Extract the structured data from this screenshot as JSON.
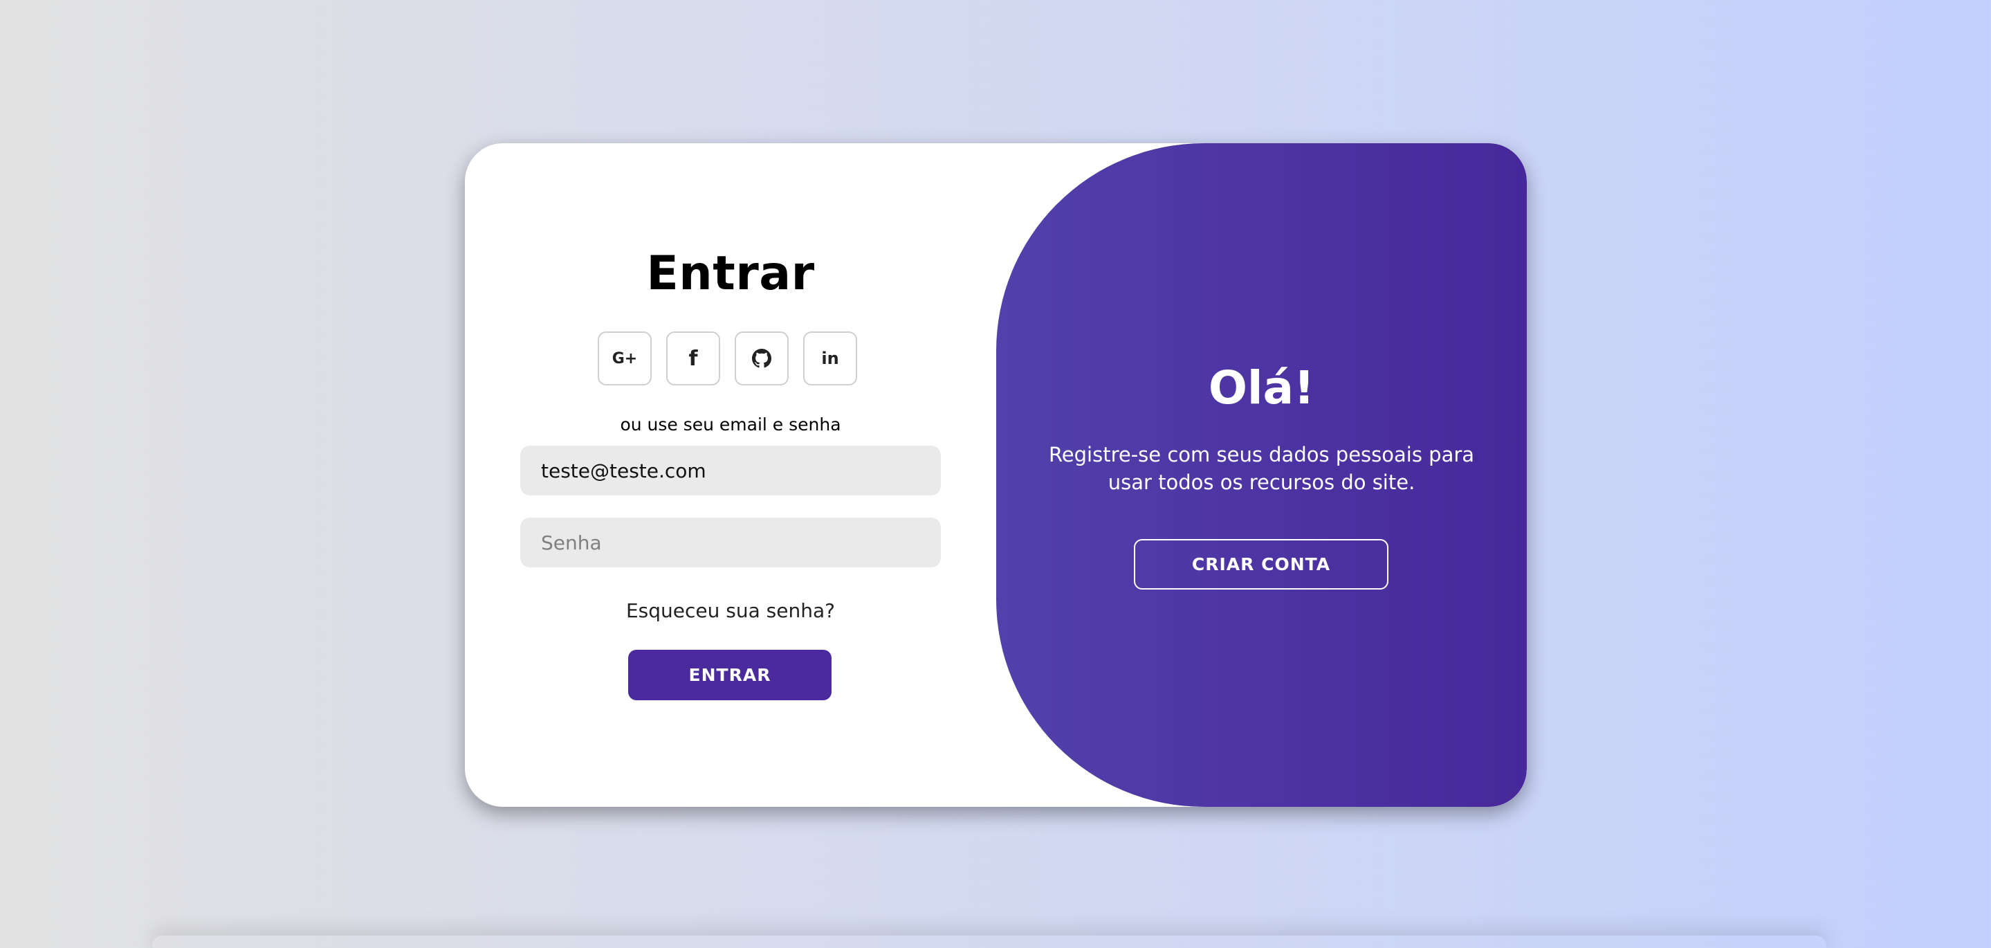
{
  "login": {
    "title": "Entrar",
    "socials": [
      {
        "icon": "google-plus-icon",
        "label": "G+"
      },
      {
        "icon": "facebook-icon",
        "label": "f"
      },
      {
        "icon": "github-icon",
        "label": ""
      },
      {
        "icon": "linkedin-icon",
        "label": "in"
      }
    ],
    "hint": "ou use seu email e senha",
    "email_value": "teste@teste.com",
    "password_placeholder": "Senha",
    "forgot_label": "Esqueceu sua senha?",
    "submit_label": "ENTRAR"
  },
  "panel": {
    "title": "Olá!",
    "text": "Registre-se com seus dados pessoais para usar todos os recursos do site.",
    "button_label": "CRIAR CONTA"
  },
  "colors": {
    "accent": "#4a2a9c",
    "panel_gradient_start": "#5241ab",
    "panel_gradient_end": "#47289a"
  }
}
